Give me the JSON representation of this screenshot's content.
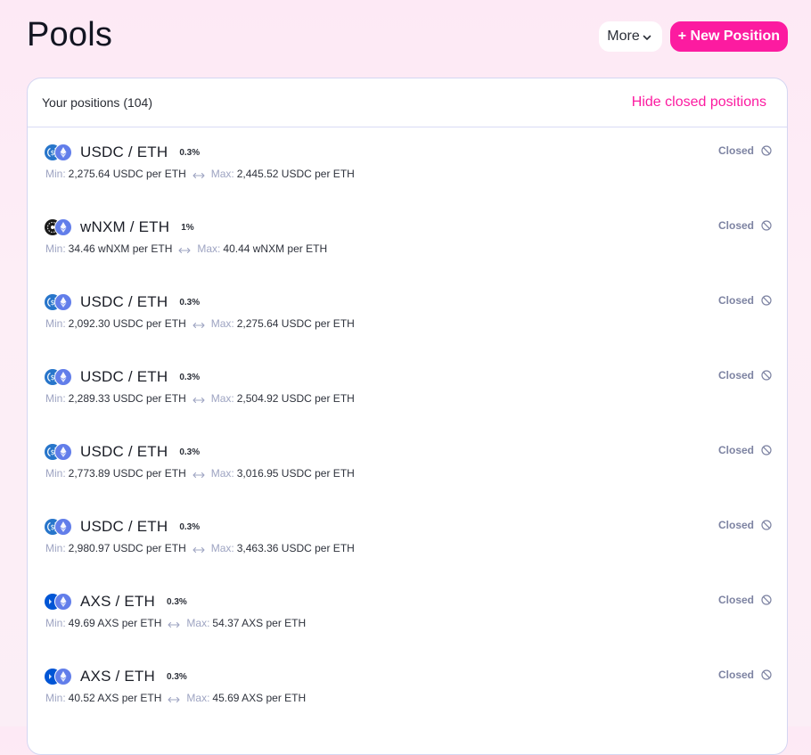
{
  "page": {
    "title": "Pools",
    "more_label": "More",
    "new_position_label": "+ New Position"
  },
  "card": {
    "positions_label": "Your positions (104)",
    "hide_closed_label": "Hide closed positions"
  },
  "colors": {
    "accent": "#fc1ba0",
    "eth": "#627eea",
    "usdc": "#2775ca",
    "axs": "#0055d5",
    "wnxm": "#1a1a1a",
    "muted": "#9ea4c2"
  },
  "positions": [
    {
      "pair": "USDC / ETH",
      "token0_icon": "usdc-icon",
      "token1_icon": "eth-icon",
      "fee": "0.3%",
      "min_label": "Min:",
      "min": "2,275.64 USDC per ETH",
      "max_label": "Max:",
      "max": "2,445.52 USDC per ETH",
      "status": "Closed"
    },
    {
      "pair": "wNXM / ETH",
      "token0_icon": "wnxm-icon",
      "token1_icon": "eth-icon",
      "fee": "1%",
      "min_label": "Min:",
      "min": "34.46 wNXM per ETH",
      "max_label": "Max:",
      "max": "40.44 wNXM per ETH",
      "status": "Closed"
    },
    {
      "pair": "USDC / ETH",
      "token0_icon": "usdc-icon",
      "token1_icon": "eth-icon",
      "fee": "0.3%",
      "min_label": "Min:",
      "min": "2,092.30 USDC per ETH",
      "max_label": "Max:",
      "max": "2,275.64 USDC per ETH",
      "status": "Closed"
    },
    {
      "pair": "USDC / ETH",
      "token0_icon": "usdc-icon",
      "token1_icon": "eth-icon",
      "fee": "0.3%",
      "min_label": "Min:",
      "min": "2,289.33 USDC per ETH",
      "max_label": "Max:",
      "max": "2,504.92 USDC per ETH",
      "status": "Closed"
    },
    {
      "pair": "USDC / ETH",
      "token0_icon": "usdc-icon",
      "token1_icon": "eth-icon",
      "fee": "0.3%",
      "min_label": "Min:",
      "min": "2,773.89 USDC per ETH",
      "max_label": "Max:",
      "max": "3,016.95 USDC per ETH",
      "status": "Closed"
    },
    {
      "pair": "USDC / ETH",
      "token0_icon": "usdc-icon",
      "token1_icon": "eth-icon",
      "fee": "0.3%",
      "min_label": "Min:",
      "min": "2,980.97 USDC per ETH",
      "max_label": "Max:",
      "max": "3,463.36 USDC per ETH",
      "status": "Closed"
    },
    {
      "pair": "AXS / ETH",
      "token0_icon": "axs-icon",
      "token1_icon": "eth-icon",
      "fee": "0.3%",
      "min_label": "Min:",
      "min": "49.69 AXS per ETH",
      "max_label": "Max:",
      "max": "54.37 AXS per ETH",
      "status": "Closed"
    },
    {
      "pair": "AXS / ETH",
      "token0_icon": "axs-icon",
      "token1_icon": "eth-icon",
      "fee": "0.3%",
      "min_label": "Min:",
      "min": "40.52 AXS per ETH",
      "max_label": "Max:",
      "max": "45.69 AXS per ETH",
      "status": "Closed"
    }
  ]
}
